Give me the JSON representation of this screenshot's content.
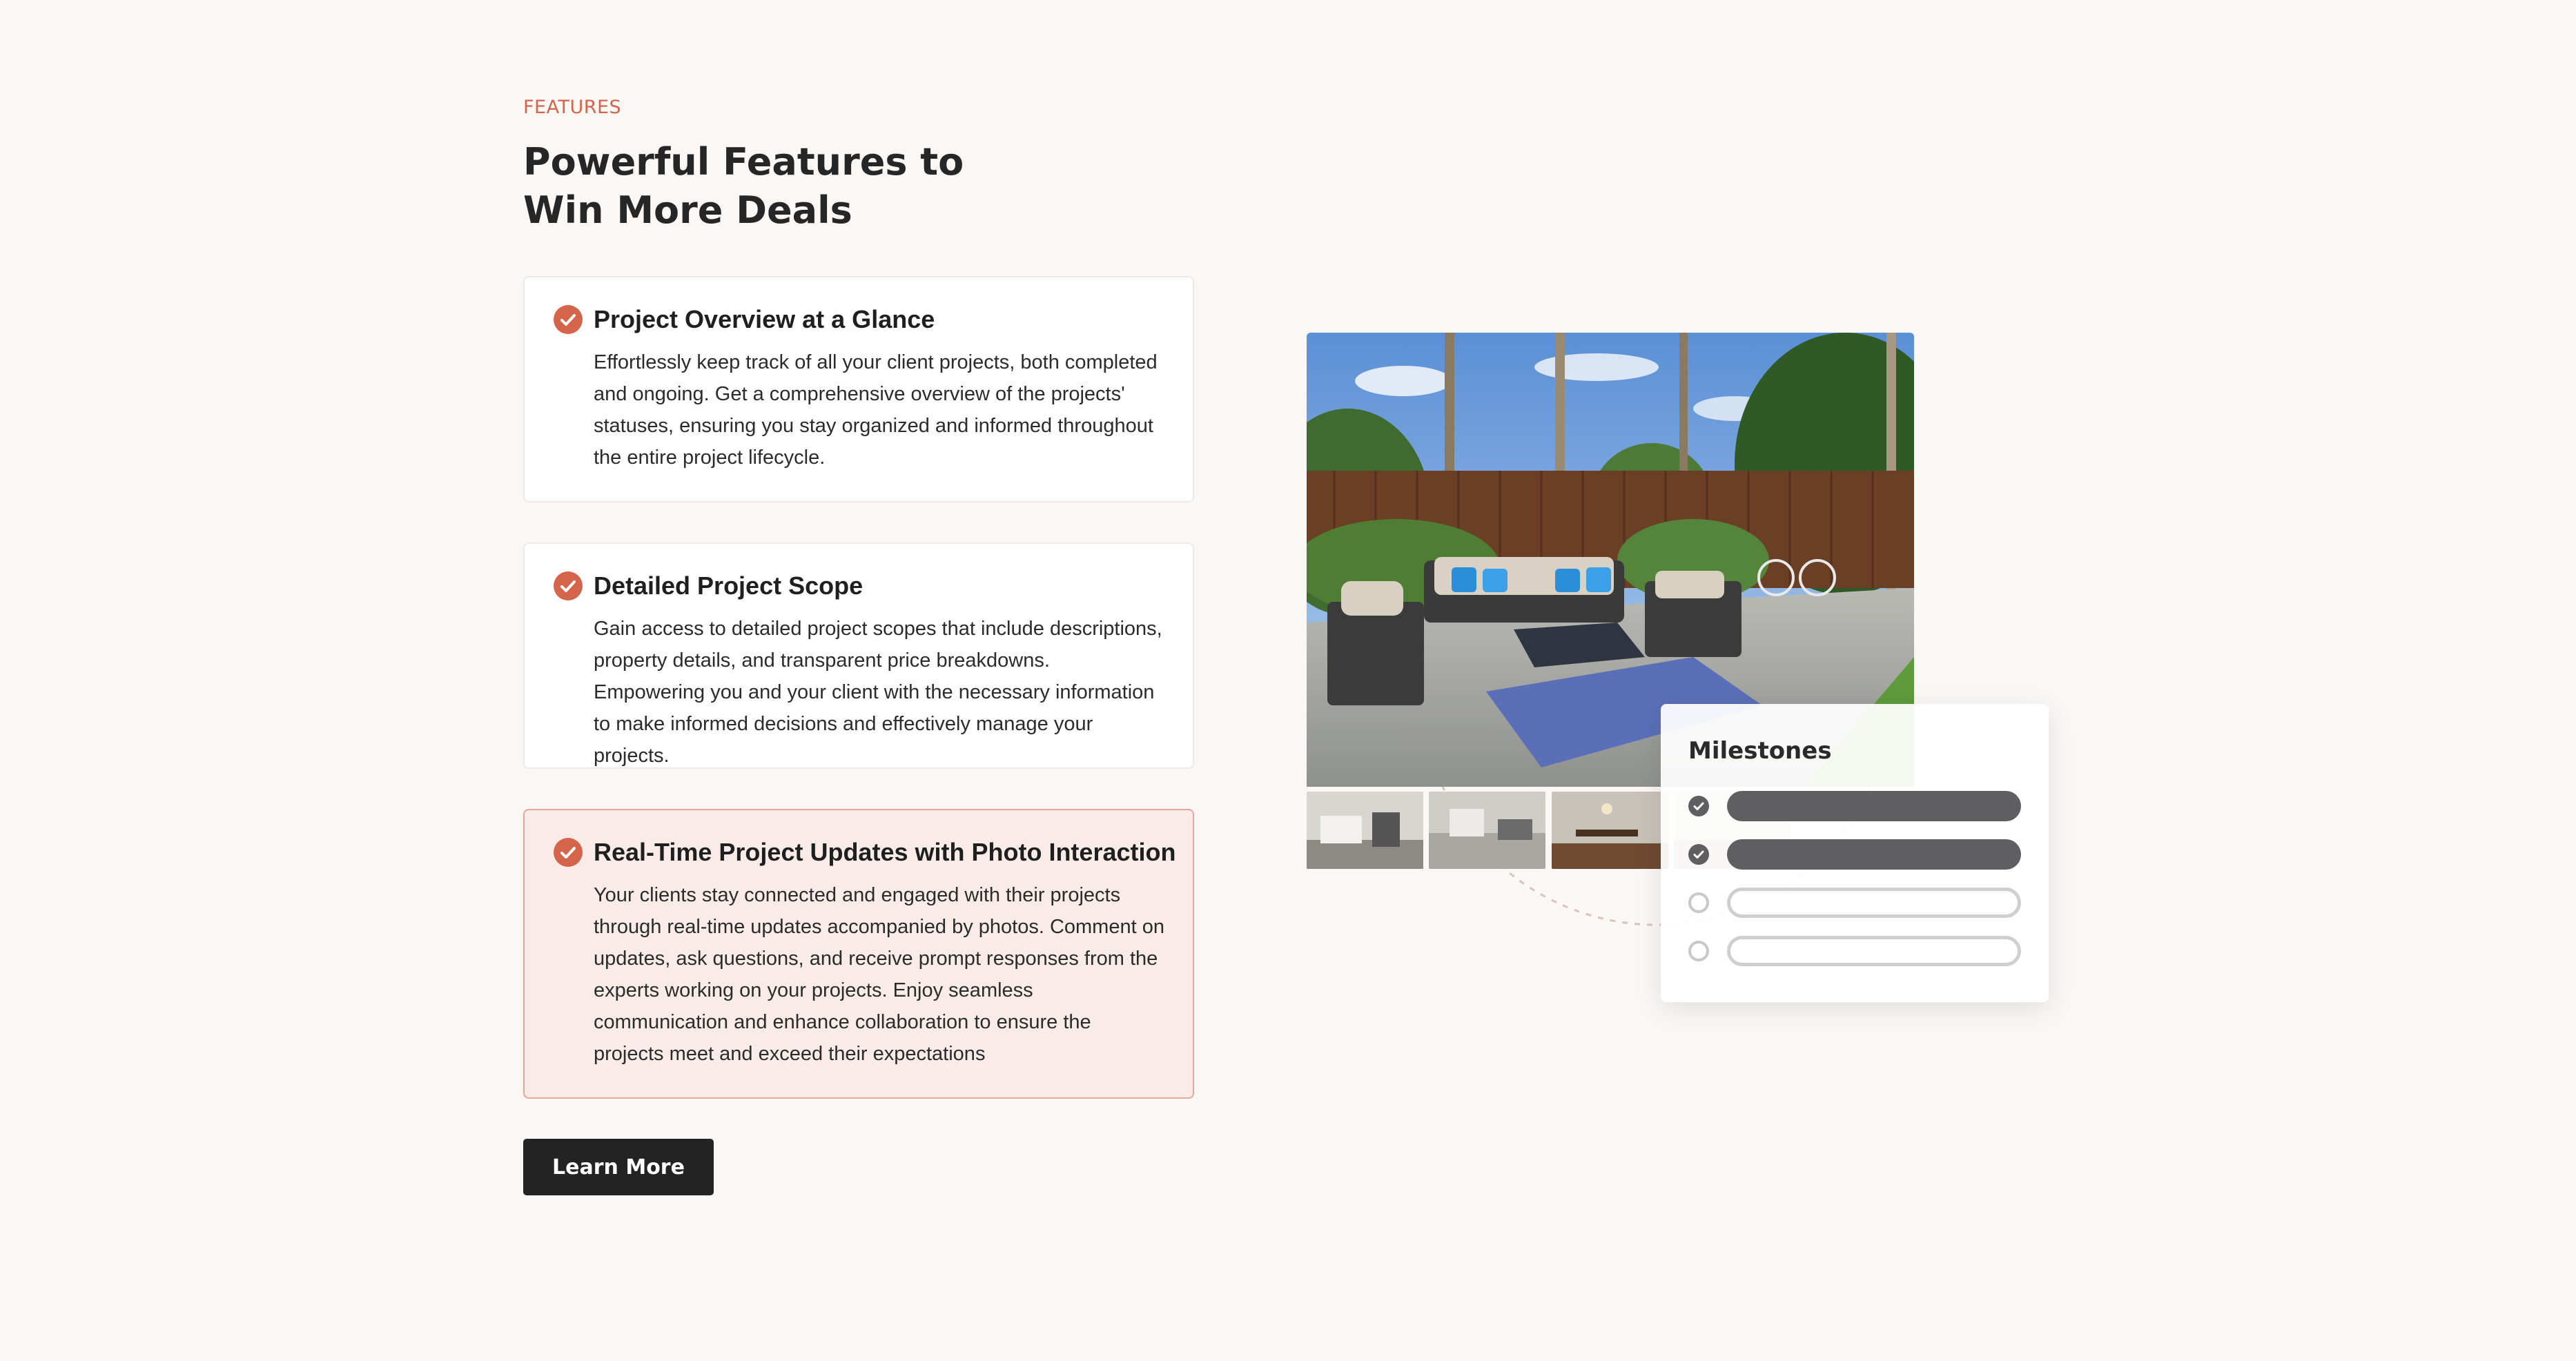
{
  "section": {
    "eyebrow": "FEATURES",
    "title": "Powerful Features to Win More Deals"
  },
  "features": [
    {
      "title": "Project Overview at a Glance",
      "body": "Effortlessly keep track of all your client projects, both completed and ongoing. Get a comprehensive overview of the projects' statuses, ensuring you stay organized and informed throughout the entire project lifecycle.",
      "active": false
    },
    {
      "title": "Detailed Project Scope",
      "body": "Gain access to detailed project scopes that include descriptions, property details, and transparent price breakdowns. Empowering you and your client with the necessary information to make informed decisions and effectively manage your projects.",
      "active": false
    },
    {
      "title": "Real-Time Project Updates with Photo Interaction",
      "body": "Your clients stay connected and engaged with their projects through real-time updates accompanied by photos. Comment on updates, ask questions, and receive prompt responses from the experts working on your projects. Enjoy seamless communication and enhance collaboration to ensure the projects meet and exceed their expectations",
      "active": true
    }
  ],
  "cta": {
    "label": "Learn More"
  },
  "milestones": {
    "title": "Milestones",
    "items": [
      {
        "status": "done"
      },
      {
        "status": "done"
      },
      {
        "status": "todo"
      },
      {
        "status": "todo"
      }
    ]
  },
  "colors": {
    "accent": "#d4654a",
    "background": "#faf7f5",
    "button": "#232323",
    "milestone_done": "#5f5f62"
  },
  "icons": [
    "check-circle-icon",
    "check-icon",
    "circle-icon"
  ]
}
